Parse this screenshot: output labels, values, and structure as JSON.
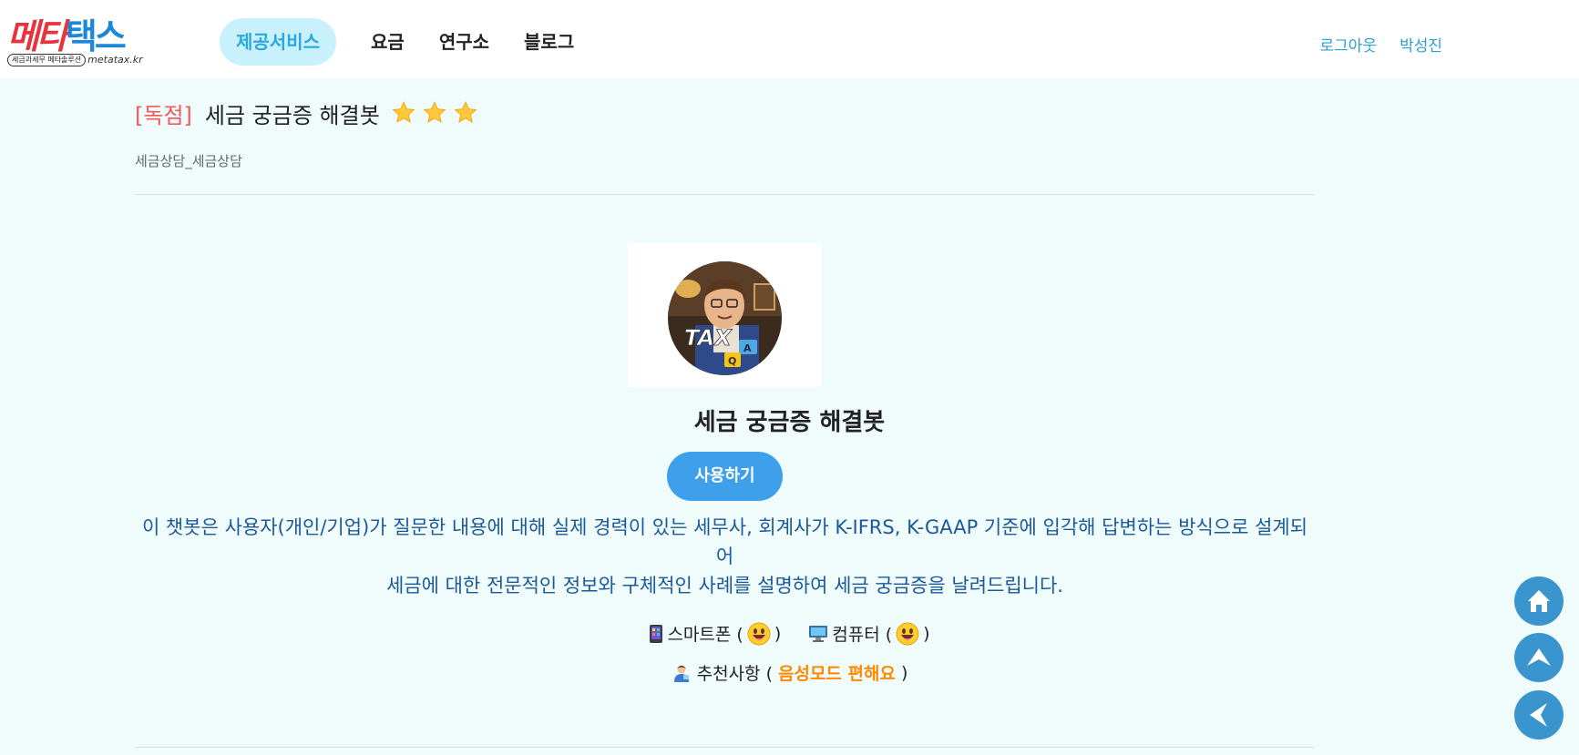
{
  "logo": {
    "part1": "메타",
    "part2": "택스",
    "tagline": "세금과세무 메타솔루션",
    "domain": "metatax.kr"
  },
  "nav": {
    "items": [
      "제공서비스",
      "요금",
      "연구소",
      "블로그"
    ]
  },
  "user": {
    "logout": "로그아웃",
    "name": "박성진"
  },
  "product": {
    "tag": "[독점]",
    "title": "세금 궁금증 해결봇",
    "rating": 3,
    "category": "세금상담_세금상담",
    "avatar_text": "TAX",
    "bot_name": "세금 궁금증 해결봇",
    "use_button": "사용하기",
    "description_line1": "이 챗봇은 사용자(개인/기업)가 질문한 내용에 대해 실제 경력이 있는 세무사, 회계사가 K-IFRS, K-GAAP 기준에 입각해 답변하는 방식으로 설계되어",
    "description_line2": "세금에 대한 전문적인 정보와 구체적인 사례를 설명하여 세금 궁금증을 날려드립니다."
  },
  "devices": {
    "smartphone": "스마트폰 (",
    "computer": "컴퓨터 (",
    "close": ")",
    "recommend_label": "추천사항 (",
    "recommend_value": "음성모드 편해요"
  },
  "colors": {
    "accent": "#3ea0ea",
    "tag": "#f05a5a",
    "highlight": "#ff8a00",
    "background": "#f0fbfc"
  }
}
